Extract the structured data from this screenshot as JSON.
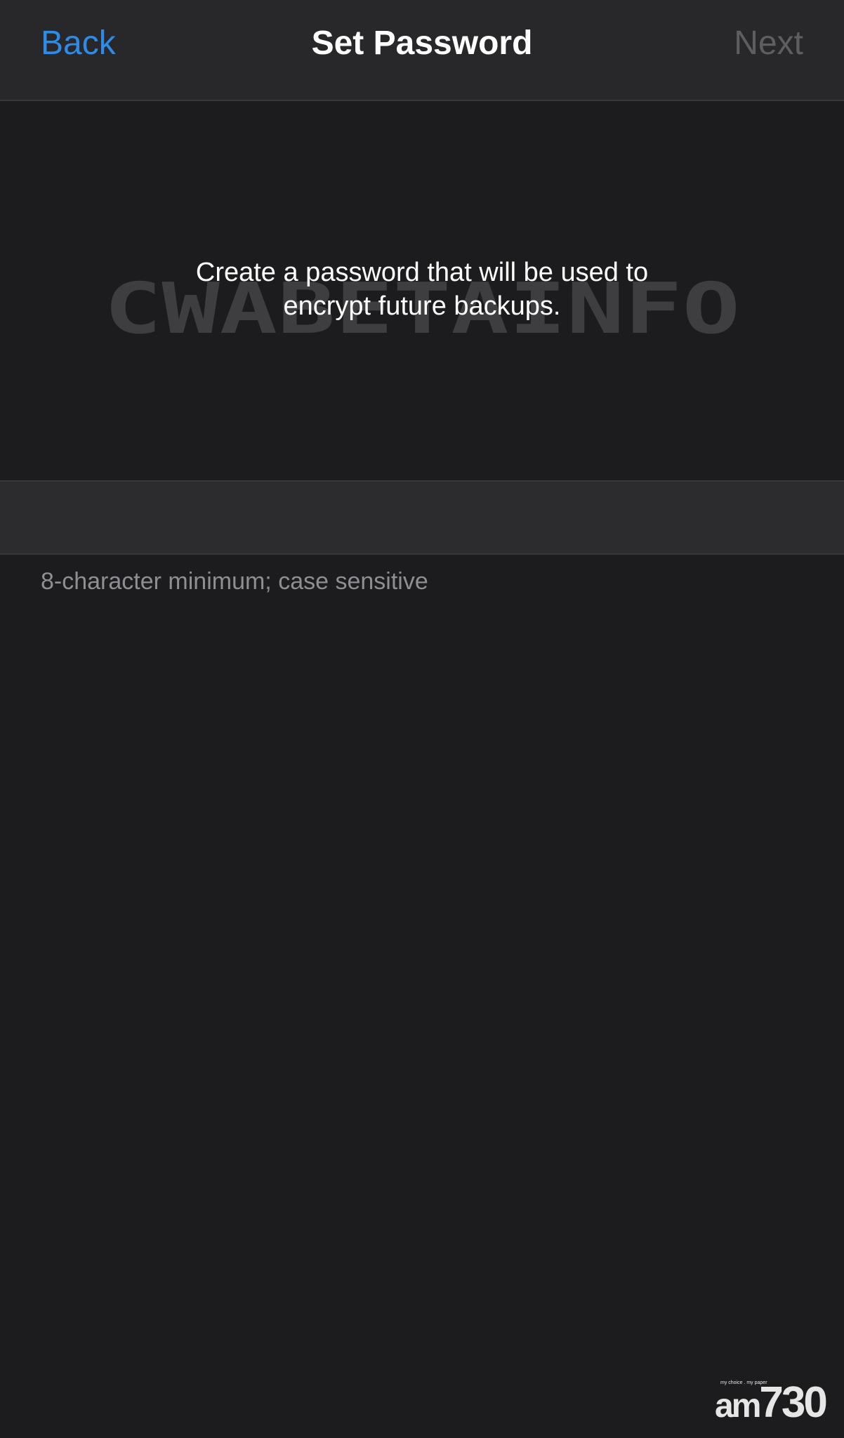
{
  "nav": {
    "back_label": "Back",
    "title": "Set Password",
    "next_label": "Next"
  },
  "description": "Create a password that will be used to\nencrypt future backups.",
  "password_field": {
    "value": "",
    "placeholder": ""
  },
  "hint": "8-character minimum; case sensitive",
  "watermark": "CWABETAINFO",
  "logo": {
    "tagline": "my choice . my paper",
    "mark_am": "am",
    "mark_num": "730"
  },
  "colors": {
    "background": "#1c1c1e",
    "nav_background": "#28282b",
    "field_background": "#2c2c2e",
    "accent": "#2f8be8",
    "disabled": "#5e5e61",
    "secondary_text": "#8e8e93"
  }
}
